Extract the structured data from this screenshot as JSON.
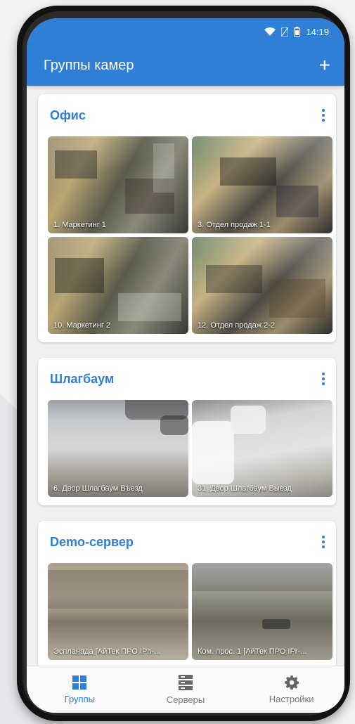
{
  "status": {
    "time": "14:19"
  },
  "appbar": {
    "title": "Группы камер",
    "add_label": "+"
  },
  "groups": [
    {
      "title": "Офис",
      "cameras": [
        "1. Маркетинг 1",
        "3. Отдел продаж 1-1",
        "10. Маркетинг 2",
        "12. Отдел продаж 2-2"
      ]
    },
    {
      "title": "Шлагбаум",
      "cameras": [
        "6. Двор Шлагбаум Въезд",
        "31. Двор Шлагбаум Выезд"
      ]
    },
    {
      "title": "Demo-сервер",
      "cameras": [
        "Эспланада [АйТек ПРО IPh-...",
        "Ком. прос. 1 [АйТек ПРО IPr-..."
      ]
    }
  ],
  "nav": {
    "groups": "Группы",
    "servers": "Серверы",
    "settings": "Настройки"
  },
  "colors": {
    "primary": "#2f7fd6"
  }
}
